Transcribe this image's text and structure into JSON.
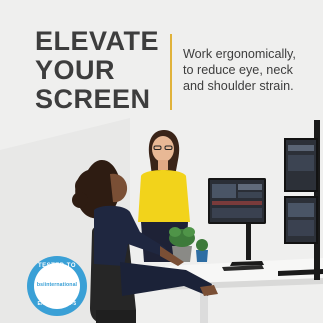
{
  "headline": {
    "line1": "ELEVATE",
    "line2": "YOUR",
    "line3": "SCREEN"
  },
  "subcopy": {
    "line1": "Work ergonomically,",
    "line2": "to reduce eye, neck",
    "line3": "and shoulder strain."
  },
  "badge": {
    "top_text": "TESTED TO",
    "brand_text": "bsiinternational",
    "bottom_text": "EN ISO 9241-5"
  },
  "colors": {
    "headline_text": "#3d3d3d",
    "accent_divider": "#e0b23a",
    "badge_blue": "#3aa0d6",
    "background": "#efefee"
  },
  "icons": {
    "certification": "bsi-certification-badge"
  }
}
